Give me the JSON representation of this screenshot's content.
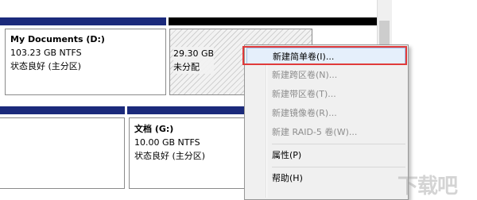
{
  "disk_top": {
    "partitions": [
      {
        "name": "My Documents  (D:)",
        "size": "103.23 GB NTFS",
        "status": "状态良好 (主分区)"
      },
      {
        "name": "",
        "size": "29.30 GB",
        "status": "未分配"
      }
    ]
  },
  "disk_bottom": {
    "partitions": [
      {
        "name": "文档  (G:)",
        "size": "10.00 GB NTFS",
        "status": "状态良好 (主分区)"
      }
    ]
  },
  "context_menu": {
    "items": [
      {
        "label": "新建简单卷(I)...",
        "enabled": true
      },
      {
        "label": "新建跨区卷(N)...",
        "enabled": false
      },
      {
        "label": "新建带区卷(T)...",
        "enabled": false
      },
      {
        "label": "新建镜像卷(R)...",
        "enabled": false
      },
      {
        "label": "新建 RAID-5 卷(W)...",
        "enabled": false
      },
      {
        "label": "属性(P)",
        "enabled": true
      },
      {
        "label": "帮助(H)",
        "enabled": true
      }
    ]
  },
  "watermark": "下载吧",
  "colors": {
    "strip_blue": "#1b2a7b",
    "strip_black": "#000000",
    "highlight": "#e03a3a"
  }
}
